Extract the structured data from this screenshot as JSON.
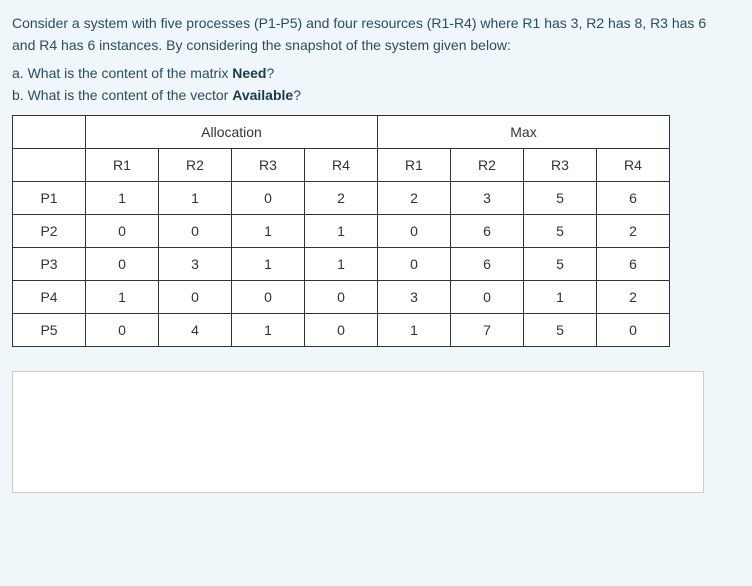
{
  "intro": {
    "line1_prefix": "Consider a system with five processes (P1-P5) and four resources (R1-R4) where R1 has ",
    "r1_total": "3",
    "mid1": ", R2 has ",
    "r2_total": "8",
    "mid2": ", R3 has ",
    "r3_total": "6",
    "line2_prefix": "and R4 has ",
    "r4_total": "6",
    "line2_suffix": " instances. By considering the snapshot of the system given below:"
  },
  "questions": {
    "a_prefix": "a. What is the content of the matrix ",
    "a_bold": "Need",
    "a_suffix": "?",
    "b_prefix": "b. What is the content of the vector ",
    "b_bold": "Available",
    "b_suffix": "?"
  },
  "table": {
    "group_allocation": "Allocation",
    "group_max": "Max",
    "headers": {
      "alloc_r1": "R1",
      "alloc_r2": "R2",
      "alloc_r3": "R3",
      "alloc_r4": "R4",
      "max_r1": "R1",
      "max_r2": "R2",
      "max_r3": "R3",
      "max_r4": "R4"
    },
    "rows": [
      {
        "label": "P1",
        "alloc": [
          "1",
          "1",
          "0",
          "2"
        ],
        "max": [
          "2",
          "3",
          "5",
          "6"
        ]
      },
      {
        "label": "P2",
        "alloc": [
          "0",
          "0",
          "1",
          "1"
        ],
        "max": [
          "0",
          "6",
          "5",
          "2"
        ]
      },
      {
        "label": "P3",
        "alloc": [
          "0",
          "3",
          "1",
          "1"
        ],
        "max": [
          "0",
          "6",
          "5",
          "6"
        ]
      },
      {
        "label": "P4",
        "alloc": [
          "1",
          "0",
          "0",
          "0"
        ],
        "max": [
          "3",
          "0",
          "1",
          "2"
        ]
      },
      {
        "label": "P5",
        "alloc": [
          "0",
          "4",
          "1",
          "0"
        ],
        "max": [
          "1",
          "7",
          "5",
          "0"
        ]
      }
    ]
  }
}
